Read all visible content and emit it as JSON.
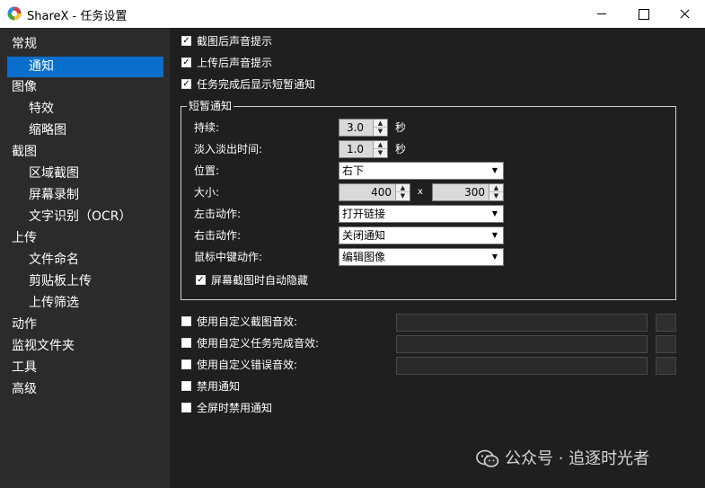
{
  "window": {
    "title": "ShareX - 任务设置"
  },
  "icons": {
    "app": "sharex-logo-icon",
    "minimize": "minimize-icon",
    "maximize": "maximize-icon",
    "close": "close-icon",
    "wechat": "wechat-icon"
  },
  "colors": {
    "selection": "#0a6fcc",
    "panel": "#1f1f1f",
    "sidebar": "#2b2b2b"
  },
  "sidebar": {
    "items": [
      {
        "label": "常规",
        "level": 1,
        "selected": false
      },
      {
        "label": "通知",
        "level": 2,
        "selected": true
      },
      {
        "label": "图像",
        "level": 1,
        "selected": false
      },
      {
        "label": "特效",
        "level": 2,
        "selected": false
      },
      {
        "label": "缩略图",
        "level": 2,
        "selected": false
      },
      {
        "label": "截图",
        "level": 1,
        "selected": false
      },
      {
        "label": "区域截图",
        "level": 2,
        "selected": false
      },
      {
        "label": "屏幕录制",
        "level": 2,
        "selected": false
      },
      {
        "label": "文字识别（OCR）",
        "level": 2,
        "selected": false
      },
      {
        "label": "上传",
        "level": 1,
        "selected": false
      },
      {
        "label": "文件命名",
        "level": 2,
        "selected": false
      },
      {
        "label": "剪贴板上传",
        "level": 2,
        "selected": false
      },
      {
        "label": "上传筛选",
        "level": 2,
        "selected": false
      },
      {
        "label": "动作",
        "level": 1,
        "selected": false
      },
      {
        "label": "监视文件夹",
        "level": 1,
        "selected": false
      },
      {
        "label": "工具",
        "level": 1,
        "selected": false
      },
      {
        "label": "高级",
        "level": 1,
        "selected": false
      }
    ]
  },
  "top_checks": [
    {
      "label": "截图后声音提示",
      "checked": true
    },
    {
      "label": "上传后声音提示",
      "checked": true
    },
    {
      "label": "任务完成后显示短暂通知",
      "checked": true
    }
  ],
  "toast": {
    "group_title": "短暂通知",
    "duration": {
      "label": "持续:",
      "value": "3.0",
      "unit": "秒"
    },
    "fade": {
      "label": "淡入淡出时间:",
      "value": "1.0",
      "unit": "秒"
    },
    "position": {
      "label": "位置:",
      "value": "右下"
    },
    "size": {
      "label": "大小:",
      "width": "400",
      "sep": "x",
      "height": "300"
    },
    "left_click": {
      "label": "左击动作:",
      "value": "打开链接"
    },
    "right_click": {
      "label": "右击动作:",
      "value": "关闭通知"
    },
    "middle_click": {
      "label": "鼠标中键动作:",
      "value": "编辑图像"
    },
    "auto_hide": {
      "label": "屏幕截图时自动隐藏",
      "checked": true
    }
  },
  "custom_sounds": [
    {
      "label": "使用自定义截图音效:",
      "checked": false,
      "path": ""
    },
    {
      "label": "使用自定义任务完成音效:",
      "checked": false,
      "path": ""
    },
    {
      "label": "使用自定义错误音效:",
      "checked": false,
      "path": ""
    }
  ],
  "bottom_checks": [
    {
      "label": "禁用通知",
      "checked": false
    },
    {
      "label": "全屏时禁用通知",
      "checked": false
    }
  ],
  "watermark": {
    "text": "公众号 · 追逐时光者"
  }
}
